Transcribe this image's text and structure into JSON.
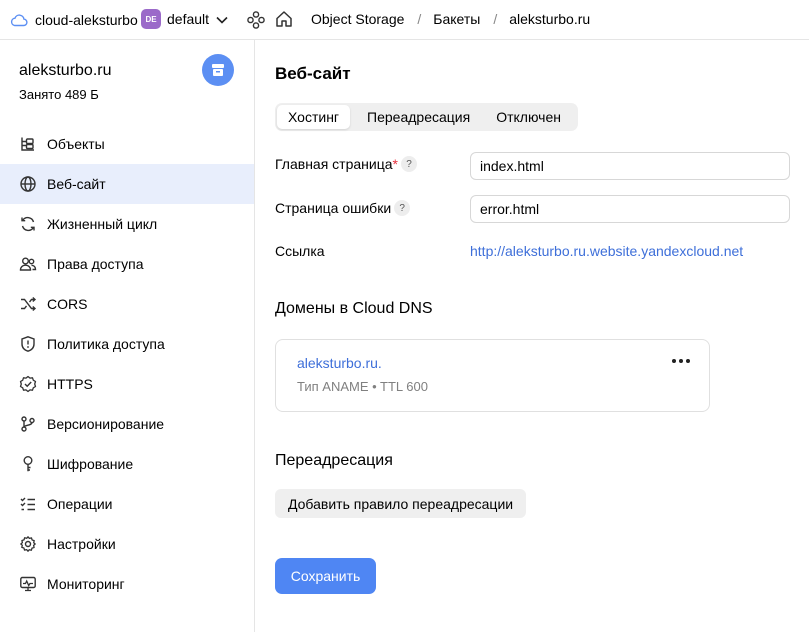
{
  "topbar": {
    "cloud_name": "cloud-aleksturbo",
    "folder_badge": "DE",
    "folder_name": "default",
    "breadcrumbs": [
      "Object Storage",
      "Бакеты",
      "aleksturbo.ru"
    ],
    "separator": "/"
  },
  "sidebar": {
    "bucket_name": "aleksturbo.ru",
    "usage": "Занято 489 Б",
    "items": [
      {
        "label": "Объекты",
        "icon": "objects-icon"
      },
      {
        "label": "Веб-сайт",
        "icon": "globe-icon",
        "active": true
      },
      {
        "label": "Жизненный цикл",
        "icon": "lifecycle-icon"
      },
      {
        "label": "Права доступа",
        "icon": "users-icon"
      },
      {
        "label": "CORS",
        "icon": "shuffle-icon"
      },
      {
        "label": "Политика доступа",
        "icon": "shield-icon"
      },
      {
        "label": "HTTPS",
        "icon": "badge-check-icon"
      },
      {
        "label": "Версионирование",
        "icon": "branch-icon"
      },
      {
        "label": "Шифрование",
        "icon": "key-icon"
      },
      {
        "label": "Операции",
        "icon": "list-check-icon"
      },
      {
        "label": "Настройки",
        "icon": "gear-icon"
      },
      {
        "label": "Мониторинг",
        "icon": "monitor-icon"
      }
    ]
  },
  "main": {
    "title": "Веб-сайт",
    "tabs": [
      "Хостинг",
      "Переадресация",
      "Отключен"
    ],
    "active_tab": "Хостинг",
    "index_page": {
      "label": "Главная страница",
      "required_mark": "*",
      "value": "index.html"
    },
    "error_page": {
      "label": "Страница ошибки",
      "value": "error.html"
    },
    "link": {
      "label": "Ссылка",
      "value": "http://aleksturbo.ru.website.yandexcloud.net"
    },
    "help_glyph": "?",
    "dns": {
      "title": "Домены в Cloud DNS",
      "domain": "aleksturbo.ru.",
      "meta": "Тип ANAME • TTL 600"
    },
    "redirect": {
      "title": "Переадресация",
      "add_button": "Добавить правило переадресации"
    },
    "save_button": "Сохранить"
  },
  "colors": {
    "accent": "#4f86f3",
    "link": "#3e6fd9",
    "active_nav_bg": "#e8eefc",
    "folder_badge": "#9b6ac9",
    "required": "#e6303d"
  }
}
